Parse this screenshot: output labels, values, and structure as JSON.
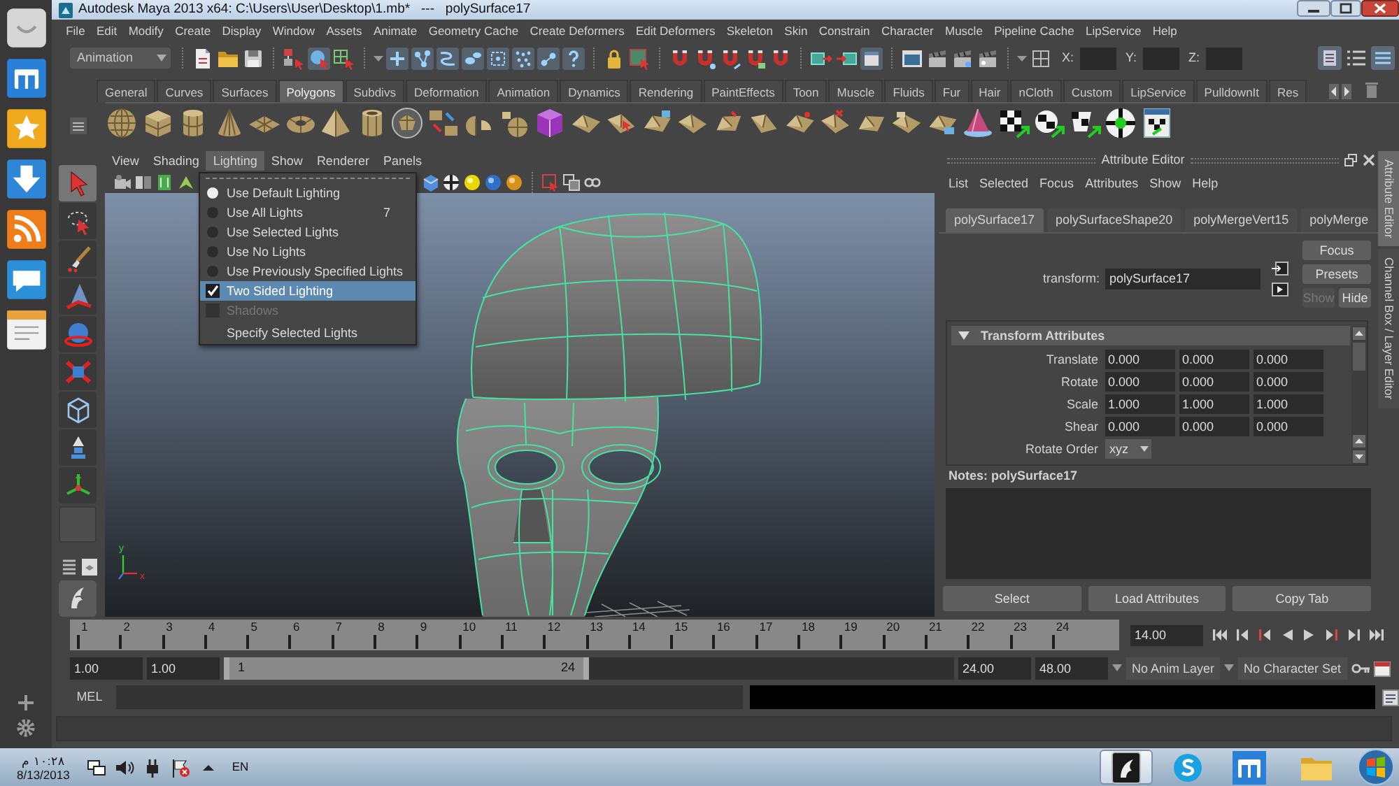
{
  "window": {
    "title": "Autodesk Maya 2013 x64: C:\\Users\\User\\Desktop\\1.mb*   ---   polySurface17"
  },
  "menu_bar": [
    "File",
    "Edit",
    "Modify",
    "Create",
    "Display",
    "Window",
    "Assets",
    "Animate",
    "Geometry Cache",
    "Create Deformers",
    "Edit Deformers",
    "Skeleton",
    "Skin",
    "Constrain",
    "Character",
    "Muscle",
    "Pipeline Cache",
    "LipService",
    "Help"
  ],
  "status_line": {
    "menu_set": "Animation",
    "coordinate_labels": [
      "X:",
      "Y:",
      "Z:"
    ]
  },
  "shelf": {
    "tabs": [
      {
        "label": "General",
        "selected": false
      },
      {
        "label": "Curves",
        "selected": false
      },
      {
        "label": "Surfaces",
        "selected": false
      },
      {
        "label": "Polygons",
        "selected": true
      },
      {
        "label": "Subdivs",
        "selected": false
      },
      {
        "label": "Deformation",
        "selected": false
      },
      {
        "label": "Animation",
        "selected": false
      },
      {
        "label": "Dynamics",
        "selected": false
      },
      {
        "label": "Rendering",
        "selected": false
      },
      {
        "label": "PaintEffects",
        "selected": false
      },
      {
        "label": "Toon",
        "selected": false
      },
      {
        "label": "Muscle",
        "selected": false
      },
      {
        "label": "Fluids",
        "selected": false
      },
      {
        "label": "Fur",
        "selected": false
      },
      {
        "label": "Hair",
        "selected": false
      },
      {
        "label": "nCloth",
        "selected": false
      },
      {
        "label": "Custom",
        "selected": false
      },
      {
        "label": "LipService",
        "selected": false
      },
      {
        "label": "PulldownIt",
        "selected": false
      },
      {
        "label": "Res",
        "selected": false
      }
    ]
  },
  "toolbox": {
    "tools": [
      {
        "selected": true
      },
      {
        "selected": false
      },
      {
        "selected": false
      },
      {
        "selected": false
      },
      {
        "selected": false
      },
      {
        "selected": false
      },
      {
        "selected": false
      },
      {
        "selected": false
      },
      {
        "selected": false
      }
    ]
  },
  "viewport": {
    "menus": [
      {
        "label": "View",
        "selected": false
      },
      {
        "label": "Shading",
        "selected": false
      },
      {
        "label": "Lighting",
        "selected": true
      },
      {
        "label": "Show",
        "selected": false
      },
      {
        "label": "Renderer",
        "selected": false
      },
      {
        "label": "Panels",
        "selected": false
      }
    ],
    "axis_labels": [
      "y",
      "x"
    ]
  },
  "lighting_menu": {
    "items": [
      {
        "kind": "radio",
        "label": "Use Default Lighting",
        "checked": true,
        "highlighted": false,
        "disabled": false
      },
      {
        "kind": "radio",
        "label": "Use All Lights",
        "shortcut": "7",
        "checked": false,
        "highlighted": false,
        "disabled": false
      },
      {
        "kind": "radio",
        "label": "Use Selected Lights",
        "checked": false,
        "highlighted": false,
        "disabled": false
      },
      {
        "kind": "radio",
        "label": "Use No Lights",
        "checked": false,
        "highlighted": false,
        "disabled": false
      },
      {
        "kind": "radio",
        "label": "Use Previously Specified Lights",
        "checked": false,
        "highlighted": false,
        "disabled": false
      },
      {
        "kind": "check",
        "label": "Two Sided Lighting",
        "checked": true,
        "highlighted": true,
        "disabled": false
      },
      {
        "kind": "check",
        "label": "Shadows",
        "checked": false,
        "highlighted": false,
        "disabled": true
      },
      {
        "kind": "command",
        "label": "Specify Selected Lights",
        "highlighted": false,
        "disabled": false
      }
    ]
  },
  "attribute_editor": {
    "title": "Attribute Editor",
    "menus": [
      "List",
      "Selected",
      "Focus",
      "Attributes",
      "Show",
      "Help"
    ],
    "tabs": [
      {
        "label": "polySurface17",
        "selected": true
      },
      {
        "label": "polySurfaceShape20",
        "selected": false
      },
      {
        "label": "polyMergeVert15",
        "selected": false
      },
      {
        "label": "polyMerge",
        "selected": false
      }
    ],
    "node_type_label": "transform:",
    "node_name": "polySurface17",
    "buttons": [
      {
        "label": "Focus",
        "disabled": false
      },
      {
        "label": "Presets",
        "disabled": false
      },
      {
        "label": "Show",
        "disabled": true
      },
      {
        "label": "Hide",
        "disabled": false
      }
    ],
    "section": {
      "title": "Transform Attributes",
      "expanded": true,
      "rows": [
        {
          "kind": "vector",
          "label": "Translate",
          "values": [
            "0.000",
            "0.000",
            "0.000"
          ]
        },
        {
          "kind": "vector",
          "label": "Rotate",
          "values": [
            "0.000",
            "0.000",
            "0.000"
          ]
        },
        {
          "kind": "vector",
          "label": "Scale",
          "values": [
            "1.000",
            "1.000",
            "1.000"
          ]
        },
        {
          "kind": "vector",
          "label": "Shear",
          "values": [
            "0.000",
            "0.000",
            "0.000"
          ]
        },
        {
          "kind": "dropdown",
          "label": "Rotate Order",
          "value": "xyz"
        }
      ]
    },
    "notes_label": "Notes: polySurface17",
    "bottom_buttons": [
      "Select",
      "Load Attributes",
      "Copy Tab"
    ]
  },
  "side_tabs": [
    {
      "label": "Attribute Editor",
      "selected": true
    },
    {
      "label": "Channel Box / Layer Editor",
      "selected": false
    }
  ],
  "time_slider": {
    "frames": [
      "1",
      "2",
      "3",
      "4",
      "5",
      "6",
      "7",
      "8",
      "9",
      "10",
      "11",
      "12",
      "13",
      "14",
      "15",
      "16",
      "17",
      "18",
      "19",
      "20",
      "21",
      "22",
      "23",
      "24"
    ],
    "current_time": "14.00"
  },
  "range_slider": {
    "start_time": "1.00",
    "playback_start": "1.00",
    "range_start": "1",
    "range_end": "24",
    "level": 0.5,
    "playback_end": "24.00",
    "end_time": "48.00",
    "anim_layer": "No Anim Layer",
    "character_set": "No Character Set"
  },
  "command_line": {
    "language": "MEL"
  },
  "taskbar": {
    "time": "١٠:٢٨ م",
    "date": "8/13/2013",
    "input_language": "EN",
    "buttons": [
      {
        "selected": true
      },
      {
        "selected": false
      },
      {
        "selected": false
      },
      {
        "selected": false
      }
    ]
  }
}
